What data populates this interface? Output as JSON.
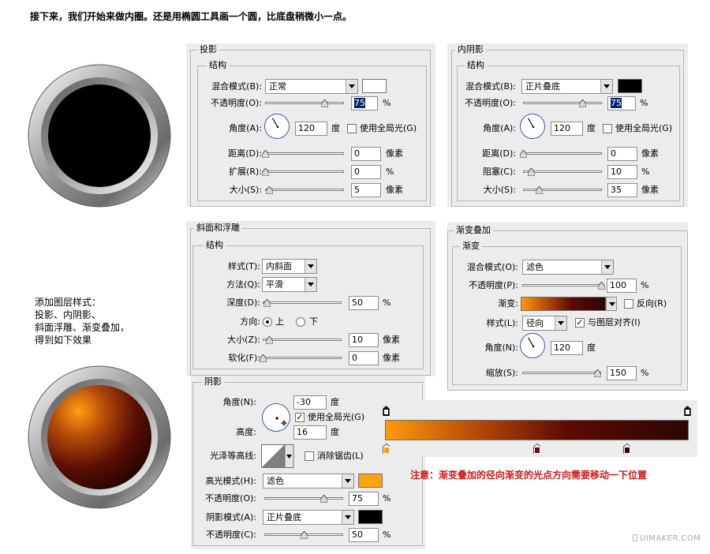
{
  "heading": "接下来，我们开始来做内圈。还是用椭圆工具画一个圆，比底盘稍微小一点。",
  "note": "添加图层样式：\n投影、内阴影、\n斜面浮雕、渐变叠加，\n得到如下效果",
  "warning": "注意：渐变叠加的径向渐变的光点方向需要移动一下位置",
  "watermark": "UIMAKER.COM",
  "colors": {
    "panel_bg": "#ececec",
    "warning": "#d01818",
    "highlight_orange": "#ffa312",
    "black": "#000000",
    "white": "#ffffff"
  },
  "drop_shadow": {
    "title": "投影",
    "group": "结构",
    "blend_label": "混合模式(B):",
    "blend_value": "正常",
    "opacity_label": "不透明度(O):",
    "opacity_value": "75",
    "opacity_unit": "%",
    "angle_label": "角度(A):",
    "angle_value": "120",
    "angle_unit": "度",
    "global_light": "使用全局光(G)",
    "distance_label": "距离(D):",
    "distance_value": "0",
    "distance_unit": "像素",
    "spread_label": "扩展(R):",
    "spread_value": "0",
    "spread_unit": "%",
    "size_label": "大小(S):",
    "size_value": "5",
    "size_unit": "像素",
    "swatch_color": "#ffffff"
  },
  "inner_shadow": {
    "title": "内阴影",
    "group": "结构",
    "blend_label": "混合模式(B):",
    "blend_value": "正片叠底",
    "opacity_label": "不透明度(O):",
    "opacity_value": "75",
    "opacity_unit": "%",
    "angle_label": "角度(A):",
    "angle_value": "120",
    "angle_unit": "度",
    "global_light": "使用全局光(G)",
    "distance_label": "距离(D):",
    "distance_value": "0",
    "distance_unit": "像素",
    "choke_label": "阻塞(C):",
    "choke_value": "10",
    "choke_unit": "%",
    "size_label": "大小(S):",
    "size_value": "35",
    "size_unit": "像素",
    "swatch_color": "#000000"
  },
  "bevel": {
    "title": "斜面和浮雕",
    "group": "结构",
    "style_label": "样式(T):",
    "style_value": "内斜面",
    "method_label": "方法(Q):",
    "method_value": "平滑",
    "depth_label": "深度(D):",
    "depth_value": "50",
    "depth_unit": "%",
    "direction_label": "方向:",
    "dir_up": "上",
    "dir_down": "下",
    "size_label": "大小(Z):",
    "size_value": "10",
    "size_unit": "像素",
    "soften_label": "软化(F):",
    "soften_value": "0",
    "soften_unit": "像素"
  },
  "shading": {
    "title": "阴影",
    "angle_label": "角度(N):",
    "angle_value": "-30",
    "angle_unit": "度",
    "global_light": "使用全局光(G)",
    "altitude_label": "高度:",
    "altitude_value": "16",
    "altitude_unit": "度",
    "gloss_label": "光泽等高线:",
    "antialias": "消除锯齿(L)",
    "highlight_label": "高光模式(H):",
    "highlight_value": "滤色",
    "highlight_opacity_label": "不透明度(O):",
    "highlight_opacity_value": "75",
    "highlight_opacity_unit": "%",
    "shadow_label": "阴影模式(A):",
    "shadow_value": "正片叠底",
    "shadow_opacity_label": "不透明度(C):",
    "shadow_opacity_value": "50",
    "shadow_opacity_unit": "%",
    "highlight_color": "#ffa312",
    "shadow_color": "#000000"
  },
  "gradient_overlay": {
    "title": "渐变叠加",
    "group": "渐变",
    "blend_label": "混合模式(O):",
    "blend_value": "滤色",
    "opacity_label": "不透明度(P):",
    "opacity_value": "100",
    "opacity_unit": "%",
    "gradient_label": "渐变:",
    "reverse": "反向(R)",
    "style_label": "样式(L):",
    "style_value": "径向",
    "align": "与图层对齐(I)",
    "angle_label": "角度(N):",
    "angle_value": "120",
    "angle_unit": "度",
    "scale_label": "缩放(S):",
    "scale_value": "150",
    "scale_unit": "%"
  }
}
